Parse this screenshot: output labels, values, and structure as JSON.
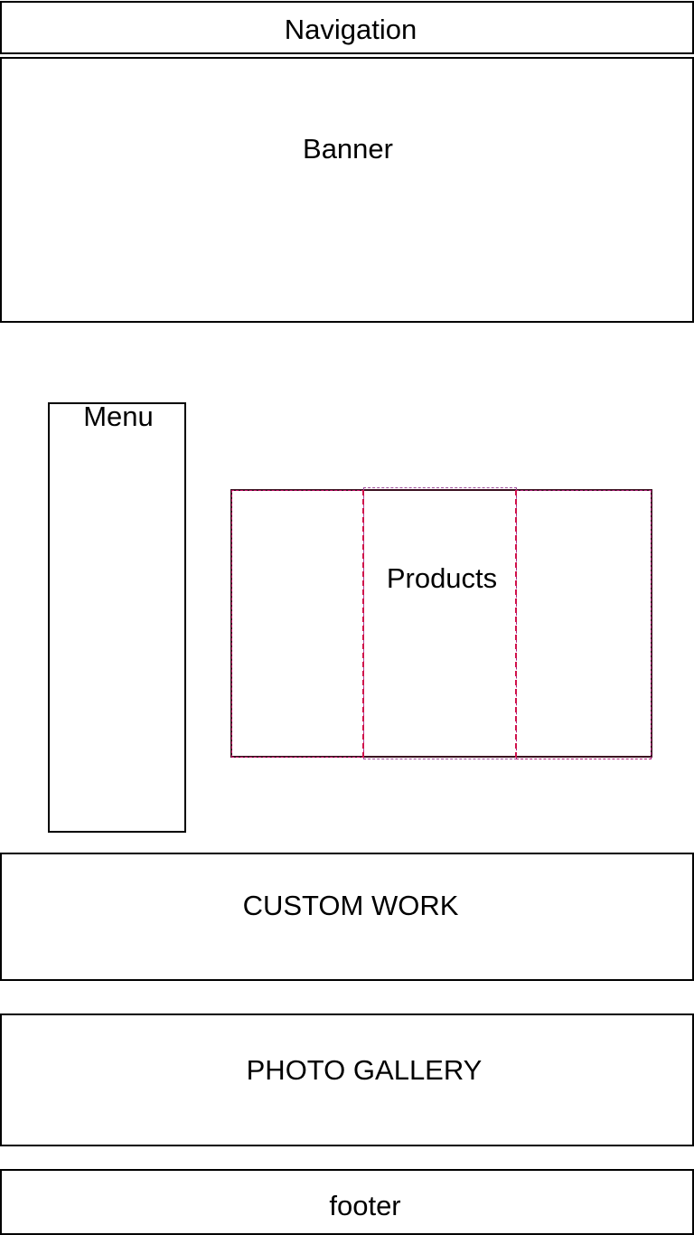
{
  "navigation": {
    "label": "Navigation"
  },
  "banner": {
    "label": "Banner"
  },
  "menu": {
    "label": "Menu"
  },
  "products": {
    "label": "Products"
  },
  "custom_work": {
    "label": "CUSTOM WORK"
  },
  "photo_gallery": {
    "label": "PHOTO GALLERY"
  },
  "footer": {
    "label": "footer"
  },
  "colors": {
    "outline": "#000000",
    "products_outline": "#3a0f1f",
    "column_dashes": "#c8106a"
  }
}
